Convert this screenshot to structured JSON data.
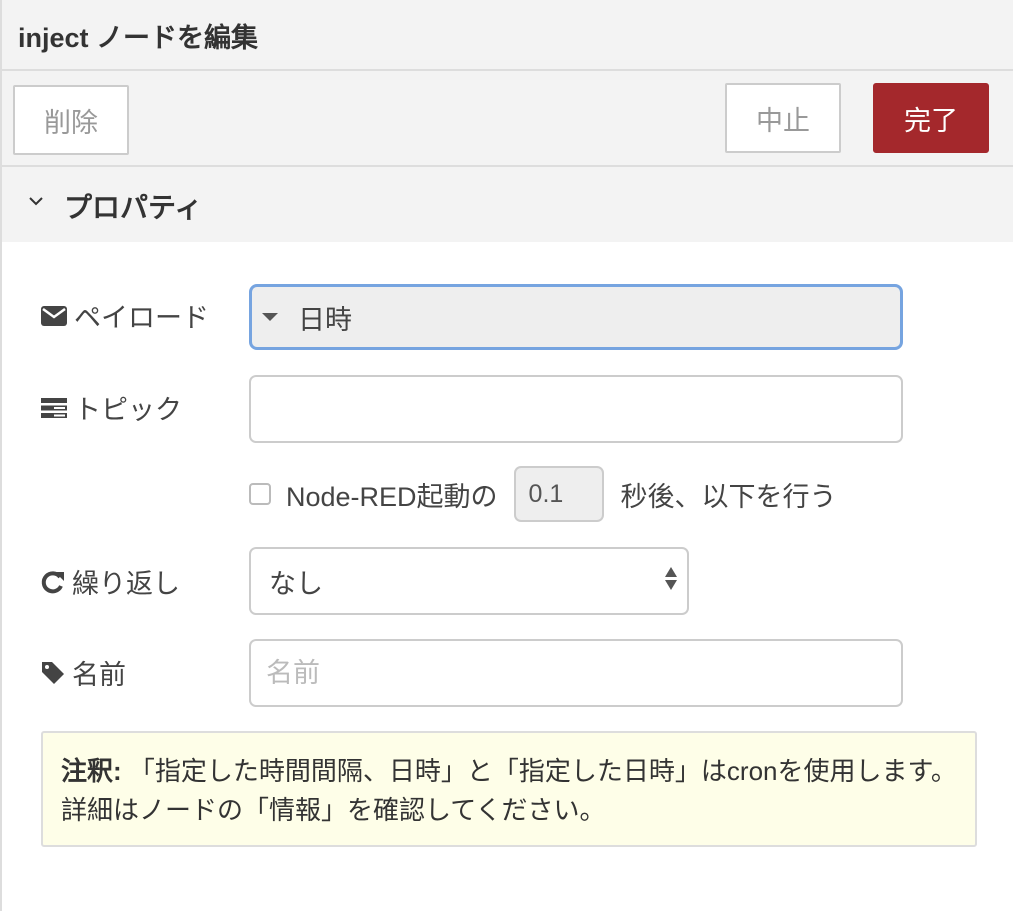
{
  "header": {
    "title": "inject ノードを編集"
  },
  "toolbar": {
    "delete_label": "削除",
    "cancel_label": "中止",
    "done_label": "完了"
  },
  "section": {
    "label": "プロパティ",
    "expanded": true
  },
  "form": {
    "payload": {
      "label": "ペイロード",
      "icon": "envelope-icon",
      "value": "日時"
    },
    "topic": {
      "label": "トピック",
      "icon": "tasks-icon",
      "value": ""
    },
    "once": {
      "checked": false,
      "label_before": "Node-RED起動の",
      "delay_value": "0.1",
      "label_after": "秒後、以下を行う"
    },
    "repeat": {
      "label": "繰り返し",
      "icon": "repeat-icon",
      "value": "なし"
    },
    "name": {
      "label": "名前",
      "icon": "tag-icon",
      "value": "",
      "placeholder": "名前"
    }
  },
  "tip": {
    "label": "注釈:",
    "text": "「指定した時間間隔、日時」と「指定した日時」はcronを使用します。詳細はノードの「情報」を確認してください。"
  },
  "colors": {
    "primary_button": "#a4282c",
    "focus_border": "#76a4e0",
    "tip_background": "#fefee8"
  }
}
